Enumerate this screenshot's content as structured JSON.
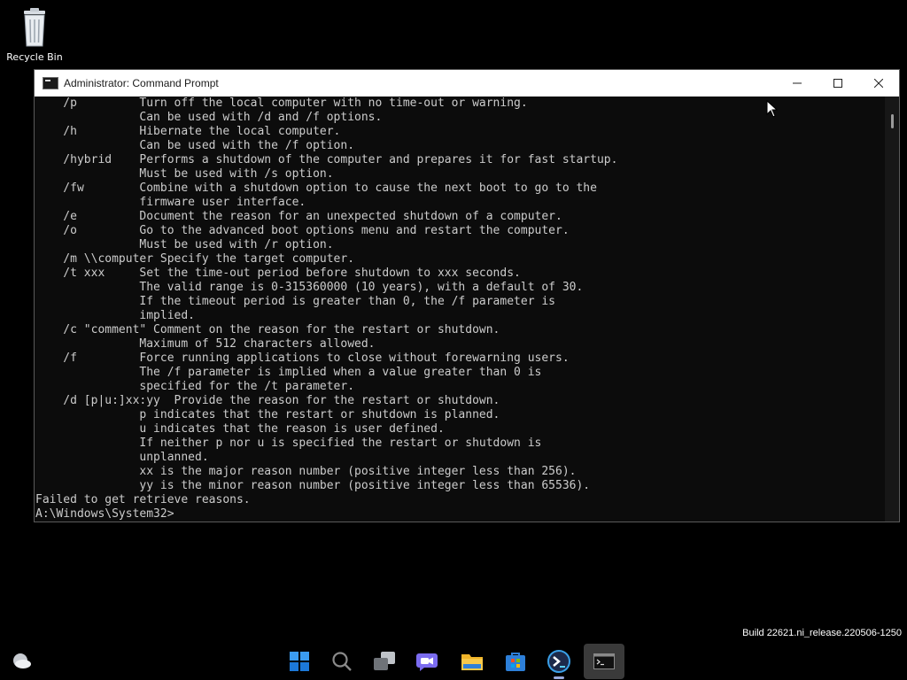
{
  "desktop": {
    "recycle_bin_label": "Recycle Bin",
    "build_text": "Build 22621.ni_release.220506-1250"
  },
  "window": {
    "title": "Administrator: Command Prompt",
    "console_text": "    /p         Turn off the local computer with no time-out or warning.\n               Can be used with /d and /f options.\n    /h         Hibernate the local computer.\n               Can be used with the /f option.\n    /hybrid    Performs a shutdown of the computer and prepares it for fast startup.\n               Must be used with /s option.\n    /fw        Combine with a shutdown option to cause the next boot to go to the\n               firmware user interface.\n    /e         Document the reason for an unexpected shutdown of a computer.\n    /o         Go to the advanced boot options menu and restart the computer.\n               Must be used with /r option.\n    /m \\\\computer Specify the target computer.\n    /t xxx     Set the time-out period before shutdown to xxx seconds.\n               The valid range is 0-315360000 (10 years), with a default of 30.\n               If the timeout period is greater than 0, the /f parameter is\n               implied.\n    /c \"comment\" Comment on the reason for the restart or shutdown.\n               Maximum of 512 characters allowed.\n    /f         Force running applications to close without forewarning users.\n               The /f parameter is implied when a value greater than 0 is\n               specified for the /t parameter.\n    /d [p|u:]xx:yy  Provide the reason for the restart or shutdown.\n               p indicates that the restart or shutdown is planned.\n               u indicates that the reason is user defined.\n               If neither p nor u is specified the restart or shutdown is\n               unplanned.\n               xx is the major reason number (positive integer less than 256).\n               yy is the minor reason number (positive integer less than 65536).\nFailed to get retrieve reasons.\nA:\\Windows\\System32>"
  },
  "taskbar": {
    "items": [
      "start-icon",
      "search-icon",
      "task-view-icon",
      "chat-icon",
      "file-explorer-icon",
      "store-icon",
      "terminal-app-icon",
      "command-prompt-icon"
    ],
    "active_item": "command-prompt-icon"
  },
  "colors": {
    "console_bg": "#0c0c0c",
    "console_text": "#cccccc",
    "titlebar_bg": "#ffffff",
    "desktop_bg": "#000000"
  }
}
